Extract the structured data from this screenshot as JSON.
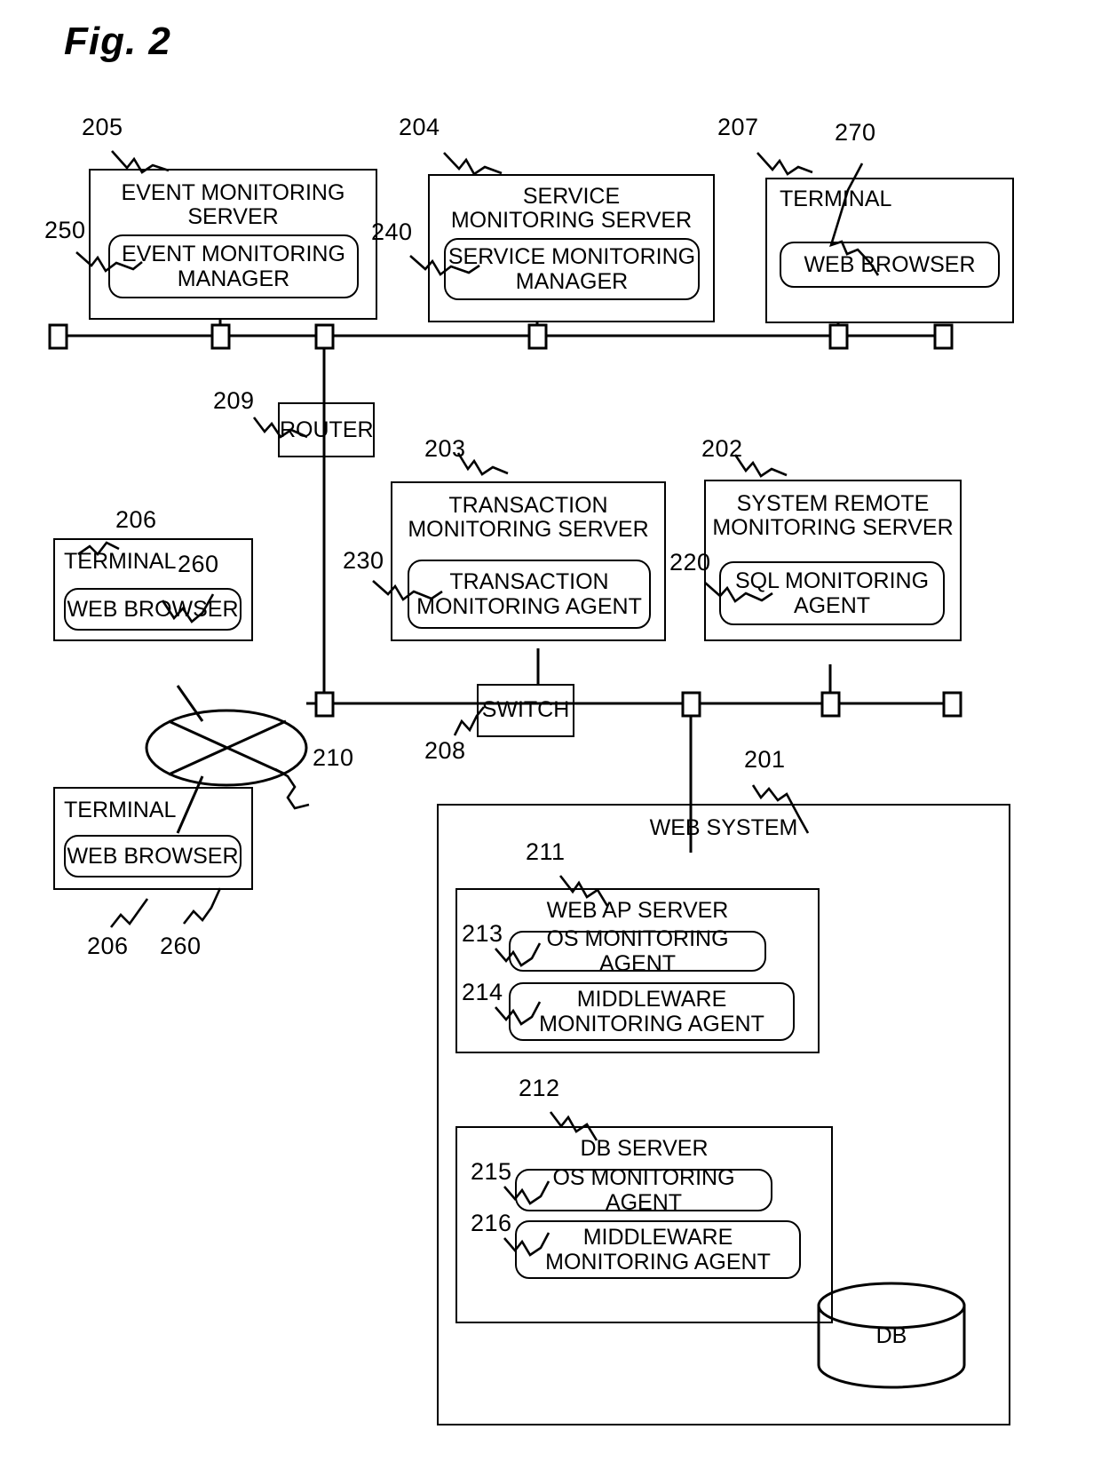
{
  "figure": {
    "title": "Fig. 2"
  },
  "nodes": {
    "event_monitoring_server": {
      "ref": "205",
      "title": "EVENT MONITORING\nSERVER",
      "inner_ref": "250",
      "inner_title": "EVENT MONITORING\nMANAGER"
    },
    "service_monitoring_server": {
      "ref": "204",
      "title": "SERVICE\nMONITORING SERVER",
      "inner_ref": "240",
      "inner_title": "SERVICE MONITORING\nMANAGER"
    },
    "terminal_top": {
      "ref": "207",
      "title": "TERMINAL",
      "inner_ref": "270",
      "inner_title": "WEB BROWSER"
    },
    "router": {
      "ref": "209",
      "title": "ROUTER"
    },
    "transaction_monitoring_server": {
      "ref": "203",
      "title": "TRANSACTION\nMONITORING SERVER",
      "inner_ref": "230",
      "inner_title": "TRANSACTION\nMONITORING AGENT"
    },
    "system_remote_monitoring_server": {
      "ref": "202",
      "title": "SYSTEM REMOTE\nMONITORING SERVER",
      "inner_ref": "220",
      "inner_title": "SQL MONITORING\nAGENT"
    },
    "terminal_mid": {
      "ref": "206",
      "title": "TERMINAL",
      "inner_ref": "260",
      "inner_title": "WEB BROWSER"
    },
    "terminal_bottom": {
      "ref": "206",
      "title": "TERMINAL",
      "inner_ref": "260",
      "inner_title": "WEB BROWSER"
    },
    "network_cloud": {
      "ref": "210"
    },
    "switch": {
      "ref": "208",
      "title": "SWITCH"
    },
    "web_system": {
      "ref": "201",
      "title": "WEB SYSTEM"
    },
    "web_ap_server": {
      "ref": "211",
      "title": "WEB AP SERVER",
      "agent1_ref": "213",
      "agent1_title": "OS MONITORING AGENT",
      "agent2_ref": "214",
      "agent2_title": "MIDDLEWARE\nMONITORING AGENT"
    },
    "db_server": {
      "ref": "212",
      "title": "DB SERVER",
      "agent1_ref": "215",
      "agent1_title": "OS MONITORING AGENT",
      "agent2_ref": "216",
      "agent2_title": "MIDDLEWARE\nMONITORING AGENT"
    },
    "database": {
      "title": "DB"
    }
  }
}
